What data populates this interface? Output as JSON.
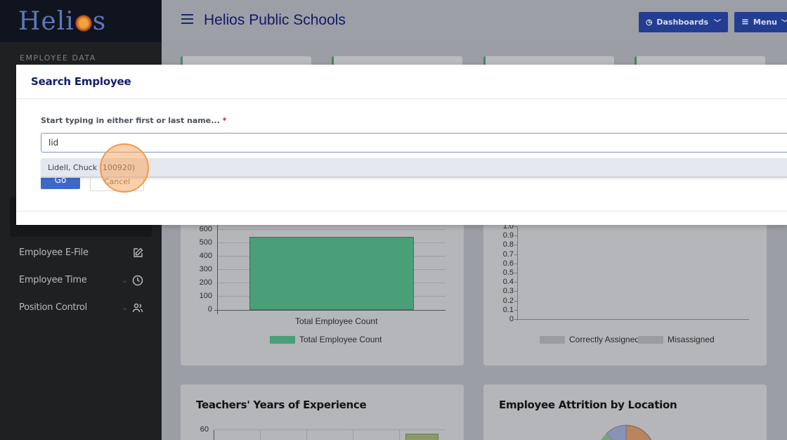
{
  "sidebar": {
    "logo_text_a": "Heli",
    "logo_text_b": "s",
    "section_label": "EMPLOYEE DATA",
    "items": [
      {
        "label": "Employee E-File",
        "icon": "edit-icon"
      },
      {
        "label": "Employee Time",
        "icon": "clock-icon"
      },
      {
        "label": "Position Control",
        "icon": "users-icon"
      }
    ]
  },
  "header": {
    "title": "Helios Public Schools",
    "dashboards_label": "Dashboards",
    "menu_label": "Menu"
  },
  "chart_left": {
    "title": "",
    "y_ticks": [
      "600",
      "500",
      "400",
      "300",
      "200",
      "100",
      "0"
    ],
    "x_label": "Total Employee Count",
    "legend": "Total Employee Count"
  },
  "chart_right": {
    "y_ticks": [
      "1.0",
      "0.9",
      "0.8",
      "0.7",
      "0.6",
      "0.5",
      "0.4",
      "0.3",
      "0.2",
      "0.1",
      "0"
    ],
    "legend": [
      "Correctly Assigned",
      "Misassigned"
    ]
  },
  "card_titles": {
    "experience": "Teachers' Years of Experience",
    "attrition": "Employee Attrition by Location"
  },
  "experience_chart": {
    "y_tick": "60"
  },
  "chart_data": [
    {
      "type": "bar",
      "categories": [
        "Total Employee Count"
      ],
      "values": [
        545
      ],
      "ylim": [
        0,
        600
      ],
      "legend": [
        "Total Employee Count"
      ]
    },
    {
      "type": "bar",
      "categories": [],
      "series": [
        {
          "name": "Correctly Assigned",
          "values": []
        },
        {
          "name": "Misassigned",
          "values": []
        }
      ],
      "ylim": [
        0,
        1.0
      ]
    }
  ],
  "modal": {
    "title": "Search Employee",
    "field_label": "Start typing in either first or last name...",
    "required_mark": "*",
    "input_value": "lid",
    "suggestion": "Lidell, Chuck (100920)",
    "go_label": "Go",
    "cancel_label": "Cancel"
  },
  "colors": {
    "accent": "#233d92",
    "title": "#131d6b",
    "bar": "#4a9e78"
  }
}
